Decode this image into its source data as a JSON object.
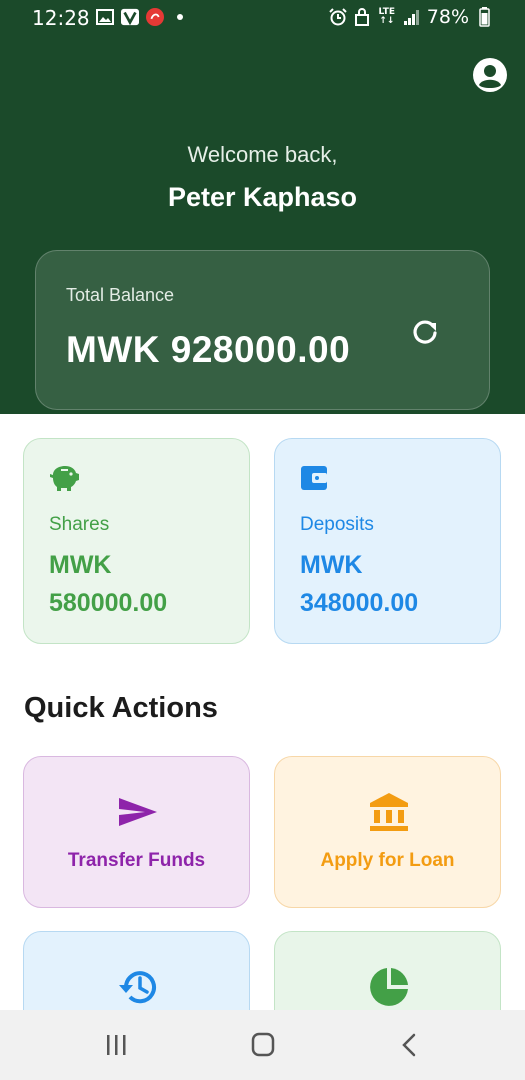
{
  "status_bar": {
    "time": "12:28",
    "lte_top": "LTE",
    "lte_bottom": "↑↓",
    "battery": "78%",
    "left_icons": [
      "gallery-icon",
      "v-app-icon",
      "airtel-icon",
      "dot-icon"
    ],
    "right_icons": [
      "alarm-icon",
      "lock-icon",
      "lte-icon",
      "signal-icon",
      "battery-icon"
    ]
  },
  "header": {
    "welcome": "Welcome back,",
    "user_name": "Peter Kaphaso",
    "profile_icon": "account-circle-icon",
    "background": "#1b4a2a"
  },
  "balance": {
    "label": "Total Balance",
    "amount": "MWK 928000.00",
    "refresh_icon": "refresh-icon"
  },
  "stats": [
    {
      "label": "Shares",
      "currency": "MWK",
      "value": "580000.00",
      "icon": "piggy-bank-icon",
      "color": "#43a047"
    },
    {
      "label": "Deposits",
      "currency": "MWK",
      "value": "348000.00",
      "icon": "wallet-icon",
      "color": "#1e88e5"
    }
  ],
  "quick_actions": {
    "title": "Quick Actions",
    "items": [
      {
        "label": "Transfer Funds",
        "icon": "send-icon",
        "color": "#8e24aa"
      },
      {
        "label": "Apply for Loan",
        "icon": "bank-icon",
        "color": "#f39c12"
      },
      {
        "label": "",
        "icon": "history-icon",
        "color": "#1e88e5"
      },
      {
        "label": "",
        "icon": "pie-chart-icon",
        "color": "#43a047"
      }
    ]
  },
  "nav_bar": {
    "buttons": [
      "recent-apps-icon",
      "home-icon",
      "back-icon"
    ]
  }
}
